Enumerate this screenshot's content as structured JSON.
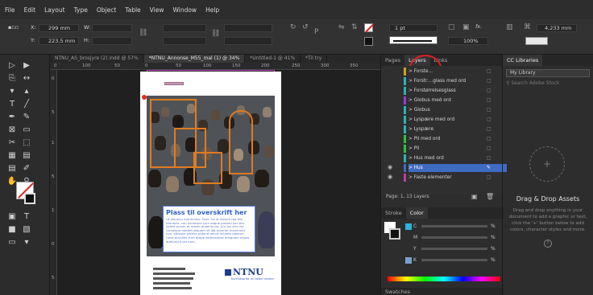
{
  "menu": [
    "File",
    "Edit",
    "Layout",
    "Type",
    "Object",
    "Table",
    "View",
    "Window",
    "Help"
  ],
  "control": {
    "x_label": "X:",
    "x_value": "299 mm",
    "y_label": "Y:",
    "y_value": "223,5 mm",
    "w_label": "W:",
    "h_label": "H:",
    "stroke_weight": "1 pt",
    "opacity": "100%",
    "size_value": "4,233 mm"
  },
  "tabs": [
    "NTNU_AS_brosjyre (2).indd @ 57%",
    "*NTNU_Annonse_M55_mal (1) @ 34%",
    "*Untitled-1 @ 41%",
    "*Til try"
  ],
  "ruler_h": [
    "0",
    "100",
    "50",
    "0",
    "50",
    "100",
    "150",
    "200",
    "250",
    "300",
    "350"
  ],
  "ruler_v": [
    "0",
    "5",
    "1",
    "5",
    "1",
    "0",
    "5"
  ],
  "document": {
    "headline": "Plass til overskrift her",
    "body": "Ut dolupiur eumendus. Tous. Ge id restum rep did, tenuenis. con nectaque sum eaque pration per bus volest pulam at resem quaerio nio. Qui qui aris mo conseque nobitet atquam sit lab autente maximinis non, adisque dellero potend omnit millatet laborae rione placilles sunt atque delinacepse atisquam aquas apetunicit est eum.",
    "logo": "NTNU",
    "motto": "Kunnskap for en bedre verden"
  },
  "layers_panel": {
    "tabs": [
      "Pages",
      "Layers",
      "Links"
    ],
    "items": [
      {
        "name": "> Forste...",
        "color": "#d4a017"
      },
      {
        "name": "> Forstr....glass med ord",
        "color": "#2bb3b3"
      },
      {
        "name": "> Forstørrelsesglass",
        "color": "#2bb3b3"
      },
      {
        "name": "> Globus med ord",
        "color": "#9b3bd1"
      },
      {
        "name": "> Globus",
        "color": "#2bb3b3"
      },
      {
        "name": "> Lyspære med ord",
        "color": "#2bb3b3"
      },
      {
        "name": "> Lyspære",
        "color": "#2bb3b3"
      },
      {
        "name": "> Pil med ord",
        "color": "#2ec436"
      },
      {
        "name": "> Pil",
        "color": "#2ec436"
      },
      {
        "name": "> Hus med ord",
        "color": "#2bb3b3"
      },
      {
        "name": "> Hus",
        "color": "#3f6cc2"
      },
      {
        "name": "> Faste elementer",
        "color": "#c43a9b"
      }
    ],
    "footer": "Page: 1, 13 Layers"
  },
  "color_panel": {
    "tabs": [
      "Stroke",
      "Color"
    ],
    "channels": [
      "C",
      "M",
      "Y",
      "K"
    ],
    "unit": "%",
    "swatches_tab": "Swatches"
  },
  "libraries": {
    "tab": "CC Libraries",
    "library": "My Library",
    "search_placeholder": "Search Adobe Stock",
    "drag_title": "Drag & Drop Assets",
    "drag_text": "Drag and drop anything in your document to add a graphic or text, click the '+' button below to add colors, character styles and more."
  }
}
